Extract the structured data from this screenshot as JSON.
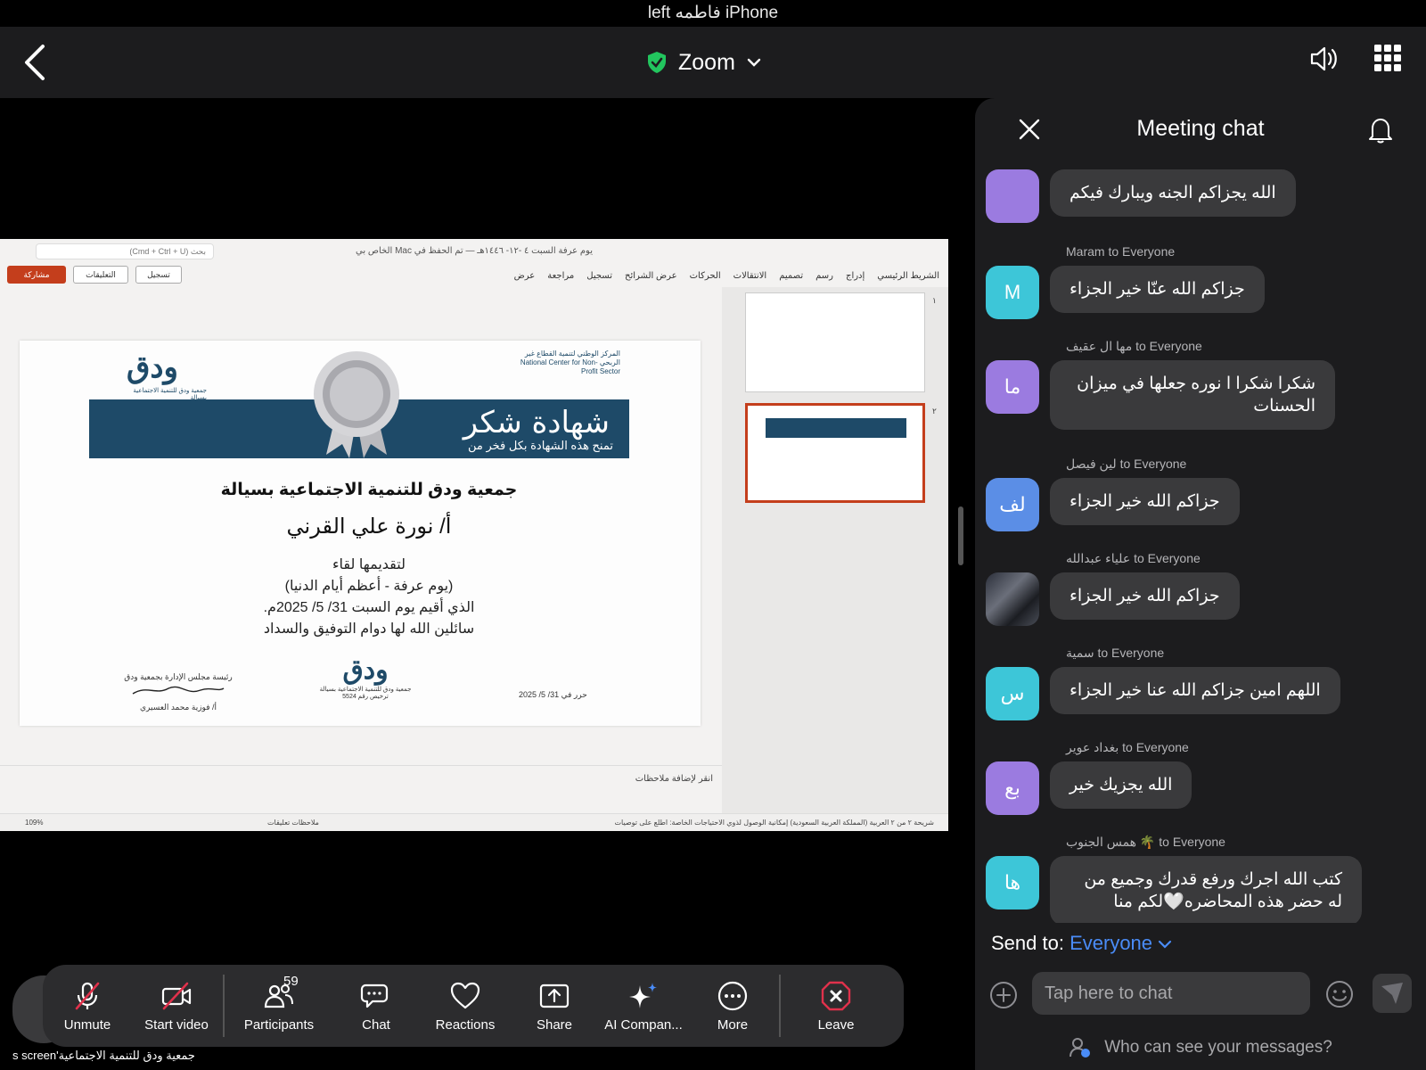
{
  "status_bar": {
    "device": "left ‎فاطمه‎ iPhone"
  },
  "top_bar": {
    "title": "Zoom"
  },
  "slide_app": {
    "doc_title": "يوم عرفة السبت ٤ -١٢- ١٤٤٦هـ — تم الحفظ في Mac الخاص بي",
    "search_placeholder": "بحث (Cmd + Ctrl + U)",
    "ribbon_tabs": [
      "الشريط الرئيسي",
      "إدراج",
      "رسم",
      "تصميم",
      "الانتقالات",
      "الحركات",
      "عرض الشرائح",
      "تسجيل",
      "مراجعة",
      "عرض"
    ],
    "share_label": "مشاركة",
    "comments_label": "التعليقات",
    "record_label": "تسجيل",
    "notes_placeholder": "انقر لإضافة ملاحظات",
    "status_right": "شريحة ٢ من ٢   العربية (المملكة العربية السعودية)   إمكانية الوصول لذوي الاحتياجات الخاصة: اطلع على توصيات",
    "status_left": "ملاحظات   تعليقات",
    "zoom_level": "109%",
    "slide_numbers": [
      "١",
      "٢"
    ]
  },
  "slide": {
    "banner_title": "شهادة شكر",
    "banner_sub": "تمنح هذه الشهادة بكل فخر من",
    "logo_left": "ودق",
    "logo_left_sub": "جمعية ودق للتنمية الاجتماعية بسيالة",
    "logo_right": "المركز الوطني لتنمية القطاع غير الربحي National Center for Non-Profit Sector",
    "org": "جمعية ودق للتنمية الاجتماعية بسيالة",
    "name": "أ/ نورة علي القرني",
    "body_lines": [
      "لتقديمها لقاء",
      "(يوم عرفة - أعظم أيام الدنيا)",
      "الذي أقيم يوم السبت 31/ 5/ 2025م.",
      "سائلين الله لها دوام التوفيق والسداد"
    ],
    "sign_title": "رئيسة مجلس الإدارة بجمعية ودق",
    "sign_name": "أ/ فوزية محمد العسيري",
    "center_logo": "ودق",
    "center_logo_sub": "جمعية ودق للتنمية الاجتماعية بسيالة",
    "center_logo_reg": "ترخيص رقم 5524",
    "date": "حرر في 31/ 5/ 2025"
  },
  "toolbar": {
    "unmute": "Unmute",
    "start_video": "Start video",
    "participants": "Participants",
    "participants_count": "59",
    "chat": "Chat",
    "reactions": "Reactions",
    "share": "Share",
    "ai_companion": "AI Compan...",
    "more": "More",
    "leave": "Leave"
  },
  "caption": "s screen'جمعية ودق للتنمية الاجتماعية",
  "chat": {
    "title": "Meeting chat",
    "send_to_label": "Send to:",
    "send_to_value": "Everyone",
    "input_placeholder": "Tap here to chat",
    "who_can_see": "Who can see your messages?",
    "messages": [
      {
        "sender": "",
        "initials": "",
        "color": "#9b7be0",
        "text": "الله يجزاكم الجنه ويبارك فيكم"
      },
      {
        "sender": "Maram to Everyone",
        "initials": "M",
        "color": "#3dc6d8",
        "text": "جزاكم الله عنّا خير الجزاء"
      },
      {
        "sender": "مها ال عقيف to Everyone",
        "initials": "ما",
        "color": "#9b7be0",
        "text": "شكرا شكرا   ا نوره جعلها في ميزان الحسنات"
      },
      {
        "sender": "لين فيصل to Everyone",
        "initials": "لف",
        "color": "#5b8ee6",
        "text": "جزاكم الله خير الجزاء"
      },
      {
        "sender": "علياء عبدالله to Everyone",
        "initials": "",
        "color": "#4a4a58",
        "text": "جزاكم الله خير الجزاء"
      },
      {
        "sender": "سمية to Everyone",
        "initials": "س",
        "color": "#3dc6d8",
        "text": "اللهم امين جزاكم الله عنا خير الجزاء"
      },
      {
        "sender": "بغداد عوير to Everyone",
        "initials": "بع",
        "color": "#9b7be0",
        "text": "الله يجزيك خير"
      },
      {
        "sender": "همس الجنوب 🌴 to Everyone",
        "initials": "ها",
        "color": "#3dc6d8",
        "text": "كتب الله اجرك ورفع قدرك وجميع من له حضر هذه  المحاضره🤍لكم منا"
      }
    ]
  },
  "colors": {
    "accent_blue": "#4a8cf7",
    "leave_red": "#e0314b",
    "shield_green": "#22c55e",
    "slide_navy": "#1e4a68",
    "ppt_orange": "#c43e1c"
  }
}
